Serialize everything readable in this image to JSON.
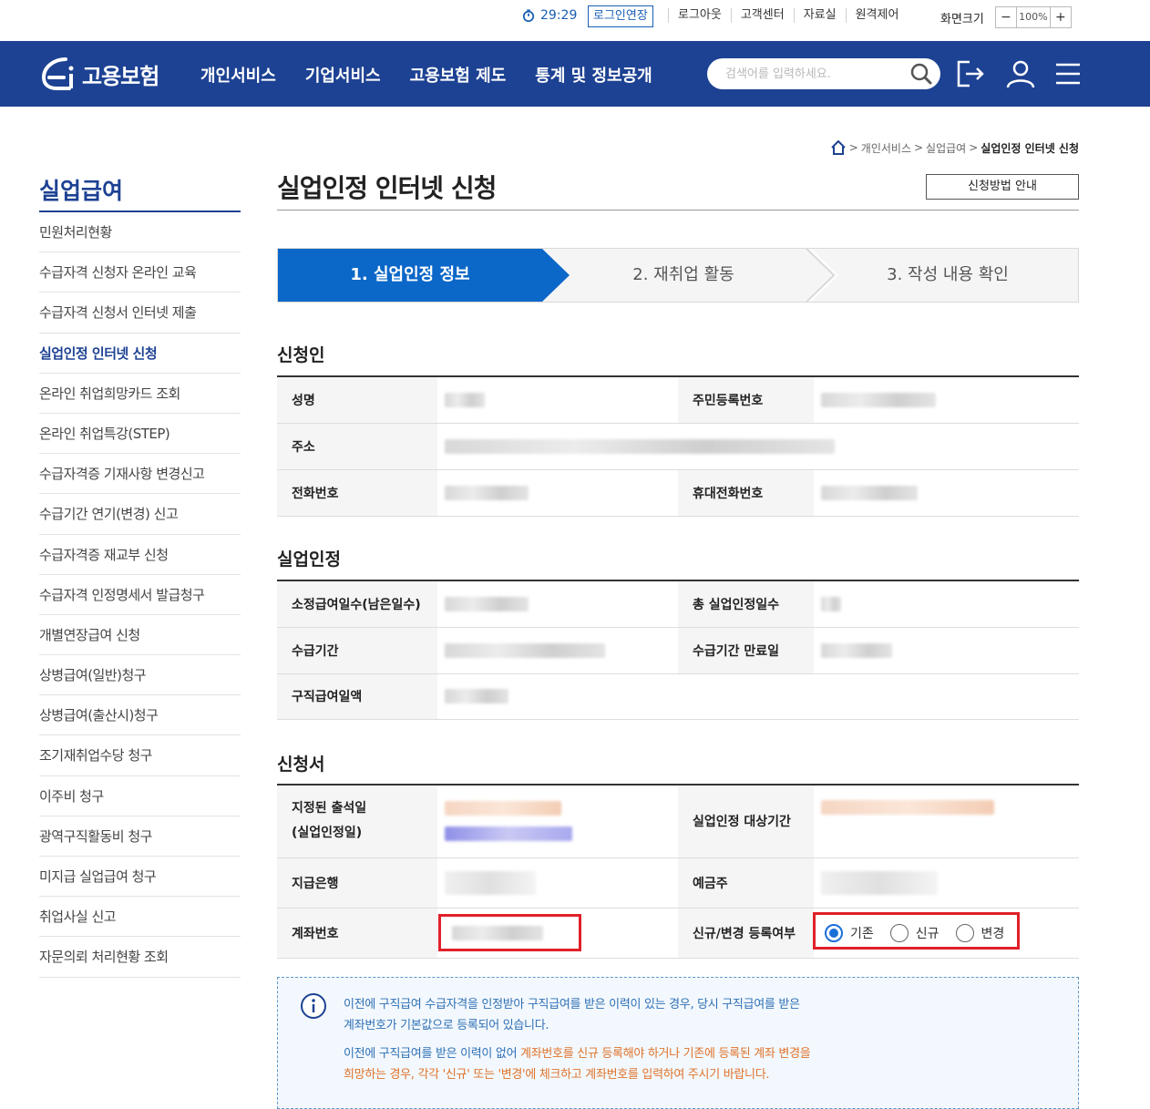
{
  "util": {
    "timer": "29:29",
    "extend_label": "로그인연장",
    "links": [
      "로그아웃",
      "고객센터",
      "자료실",
      "원격제어"
    ],
    "zoom_label": "화면크기",
    "zoom_minus": "−",
    "zoom_value": "100%",
    "zoom_plus": "+"
  },
  "header": {
    "logo_text": "고용보험",
    "nav": [
      "개인서비스",
      "기업서비스",
      "고용보험 제도",
      "통계 및 정보공개"
    ],
    "search_placeholder": "검색어를 입력하세요."
  },
  "breadcrumb": {
    "items": [
      "개인서비스",
      "실업급여"
    ],
    "current": "실업인정 인터넷 신청",
    "separator": ">"
  },
  "sidebar": {
    "title": "실업급여",
    "items": [
      "민원처리현황",
      "수급자격 신청자 온라인 교육",
      "수급자격 신청서 인터넷 제출",
      "실업인정 인터넷 신청",
      "온라인 취업희망카드 조회",
      "온라인 취업특강(STEP)",
      "수급자격증 기재사항 변경신고",
      "수급기간 연기(변경) 신고",
      "수급자격증 재교부 신청",
      "수급자격 인정명세서 발급청구",
      "개별연장급여 신청",
      "상병급여(일반)청구",
      "상병급여(출산시)청구",
      "조기재취업수당 청구",
      "이주비 청구",
      "광역구직활동비 청구",
      "미지급 실업급여 청구",
      "취업사실 신고",
      "자문의뢰 처리현황 조회"
    ],
    "active_index": 3
  },
  "main": {
    "title": "실업인정 인터넷 신청",
    "guide_button": "신청방법 안내",
    "steps": [
      "1. 실업인정 정보",
      "2. 재취업 활동",
      "3. 작성 내용 확인"
    ],
    "active_step": 0
  },
  "applicant": {
    "section_title": "신청인",
    "name_label": "성명",
    "rrn_label": "주민등록번호",
    "address_label": "주소",
    "phone_label": "전화번호",
    "mobile_label": "휴대전화번호"
  },
  "recognition": {
    "section_title": "실업인정",
    "days_label": "소정급여일수(남은일수)",
    "total_label": "총 실업인정일수",
    "period_label": "수급기간",
    "expiry_label": "수급기간 만료일",
    "daily_label": "구직급여일액"
  },
  "form": {
    "section_title": "신청서",
    "attendance_label_1": "지정된 출석일",
    "attendance_label_2": "(실업인정일)",
    "target_period_label": "실업인정 대상기간",
    "bank_label": "지급은행",
    "holder_label": "예금주",
    "account_label": "계좌번호",
    "register_label": "신규/변경 등록여부",
    "options": [
      "기존",
      "신규",
      "변경"
    ],
    "selected_option": 0
  },
  "notice": {
    "line1": "이전에 구직급여 수급자격을 인정받아 구직급여를 받은 이력이 있는 경우, 당시 구직급여를 받은",
    "line2": "계좌번호가 기본값으로 등록되어 있습니다.",
    "line3_a": "이전에 구직급여를 받은 이력이 없어 ",
    "line3_b": "계좌번호를 신규 등록해야 하거나 기존에 등록된 계좌 변경을",
    "line4": "희망하는 경우, 각각 '신규' 또는 '변경'에 체크하고 계좌번호를 입력하여 주시기 바랍니다."
  },
  "colors": {
    "brand": "#1d4293",
    "step_active": "#0b67c8",
    "highlight": "#e0202a"
  }
}
